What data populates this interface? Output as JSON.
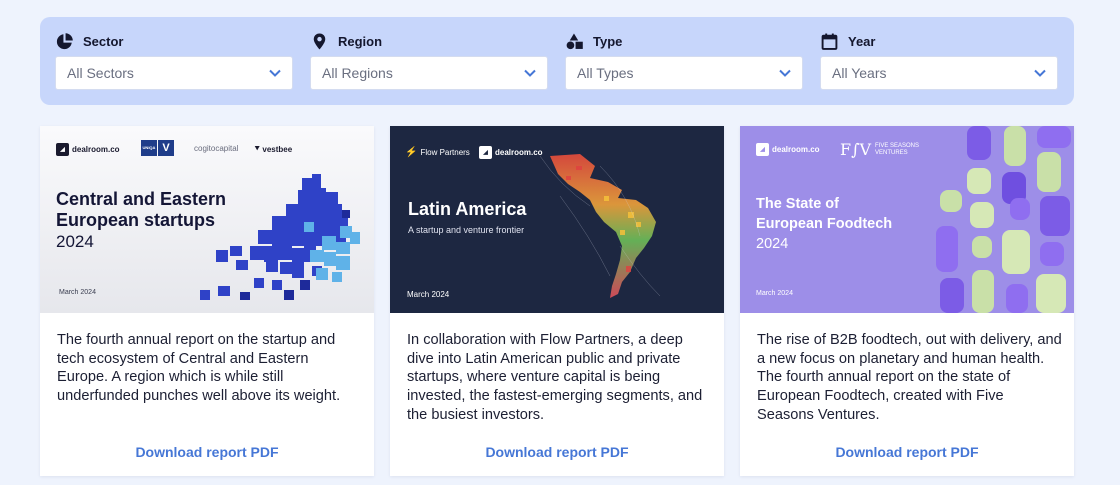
{
  "filters": [
    {
      "label": "Sector",
      "value": "All Sectors",
      "icon": "pie-chart-icon"
    },
    {
      "label": "Region",
      "value": "All Regions",
      "icon": "map-pin-icon"
    },
    {
      "label": "Type",
      "value": "All Types",
      "icon": "shapes-icon"
    },
    {
      "label": "Year",
      "value": "All Years",
      "icon": "calendar-icon"
    }
  ],
  "cards": [
    {
      "cover": {
        "logos": [
          "dealroom.co",
          "cogitocapital",
          "vestbee"
        ],
        "logo_badge": "UNIQA",
        "title_line1": "Central and Eastern",
        "title_line2": "European startups",
        "year": "2024",
        "date": "March 2024"
      },
      "description": "The fourth annual report on the startup and tech ecosystem of Central and Eastern Europe. A region which is while still underfunded punches well above its weight.",
      "link": "Download report PDF"
    },
    {
      "cover": {
        "logos": [
          "Flow Partners",
          "dealroom.co"
        ],
        "title": "Latin America",
        "subtitle": "A startup and venture frontier",
        "date": "March 2024"
      },
      "description": "In collaboration with Flow Partners, a deep dive into Latin American public and private startups, where venture capital is being invested, the fastest-emerging segments, and the busiest investors.",
      "link": "Download report PDF"
    },
    {
      "cover": {
        "logos": [
          "dealroom.co",
          "FIVE SEASONS",
          "VENTURES"
        ],
        "logo_mark": "F∫V",
        "title_line1": "The State of",
        "title_line2": "European Foodtech",
        "year": "2024",
        "date": "March 2024"
      },
      "description": "The rise of B2B foodtech, out with delivery, and a new focus on planetary and human health. The fourth annual report on the state of European Foodtech, created with Five Seasons Ventures.",
      "link": "Download report PDF"
    }
  ],
  "colors": {
    "page_bg": "#eef3fd",
    "filter_panel": "#c7d6fb",
    "link": "#4677d6",
    "cover2_bg": "#1d2741",
    "cover3_bg": "#9d8ee8"
  }
}
